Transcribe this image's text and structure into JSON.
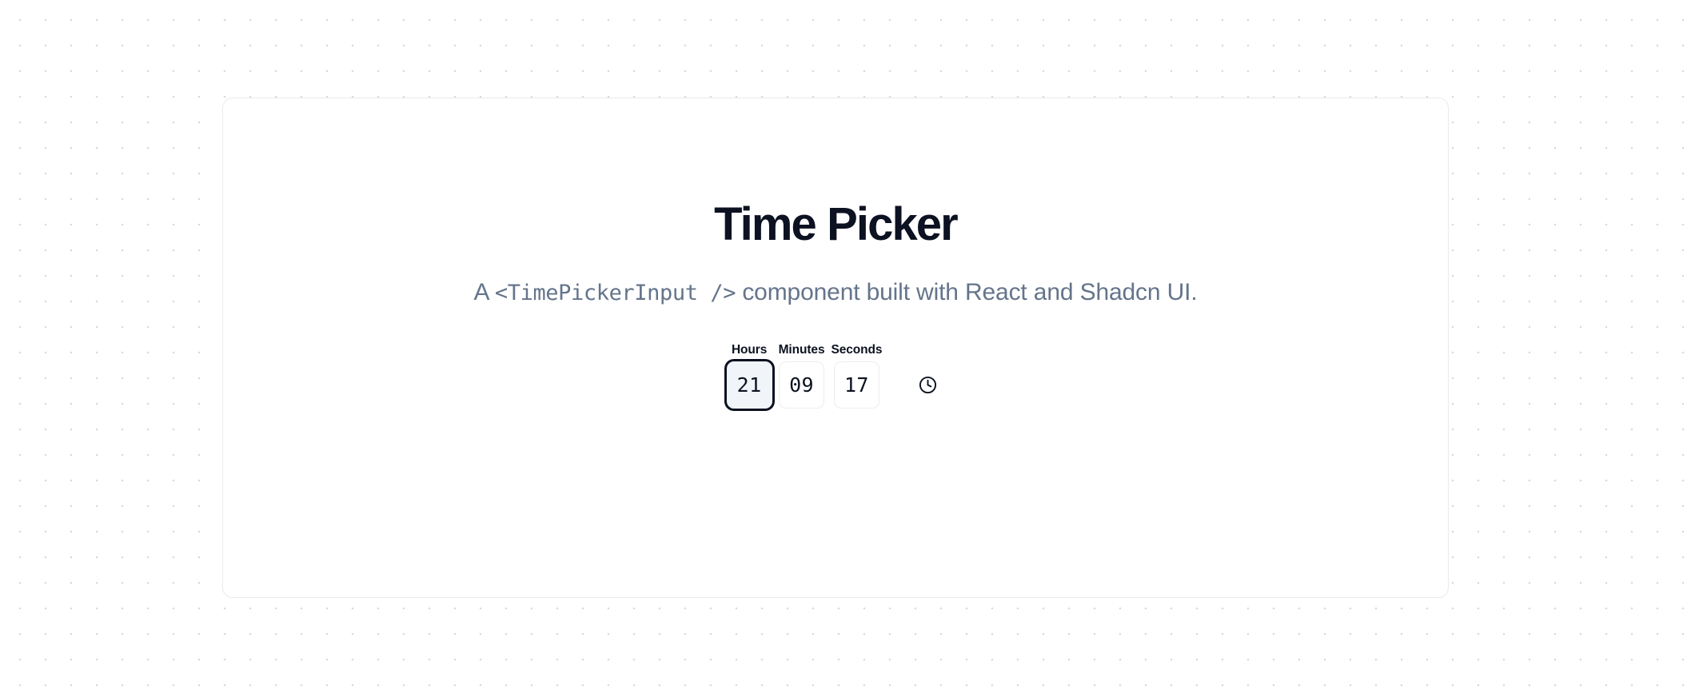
{
  "card": {
    "title": "Time Picker",
    "subtitle": {
      "lead": "A ",
      "code": "<TimePickerInput />",
      "tail": " component built with React and Shadcn UI."
    }
  },
  "time_picker": {
    "fields": [
      {
        "id": "hours",
        "label": "Hours",
        "value": "21",
        "focused": true
      },
      {
        "id": "minutes",
        "label": "Minutes",
        "value": "09",
        "focused": false
      },
      {
        "id": "seconds",
        "label": "Seconds",
        "value": "17",
        "focused": false
      }
    ],
    "clock_icon": "clock-icon"
  },
  "theme": {
    "page_background": "#ffffff",
    "dot_color": "#d8dadd",
    "card_border": "#e9eaec",
    "title_color": "#0d1222",
    "subtitle_color": "#64748b",
    "label_color": "#0c1220",
    "input_border": "#ededf0",
    "focus_ring": "#0b1120",
    "focus_fill": "#f1f5f9"
  }
}
